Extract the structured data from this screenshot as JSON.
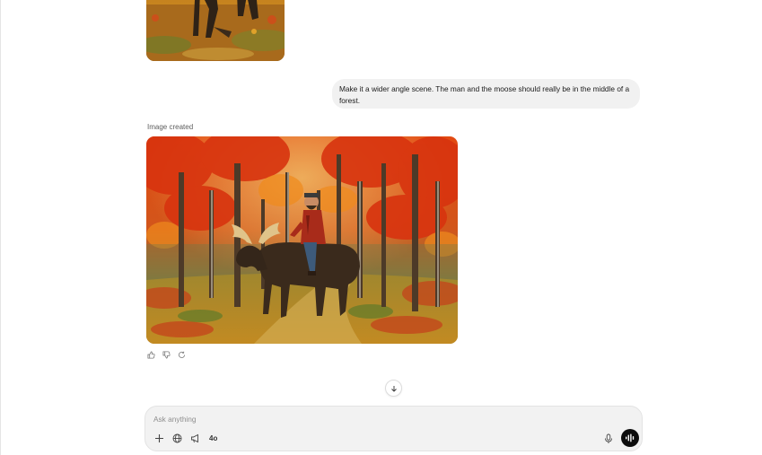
{
  "conversation": {
    "user_message": "Make it a wider angle scene. The man and the moose should really be in the middle of a forest.",
    "image_caption": "Image created"
  },
  "composer": {
    "placeholder": "Ask anything",
    "model_label": "4o"
  },
  "icons": {
    "add": "plus-icon",
    "search": "globe-icon",
    "tools": "megaphone-icon",
    "mic": "microphone-icon",
    "voice": "voice-mode-icon",
    "thumbs_up": "thumbs-up-icon",
    "thumbs_down": "thumbs-down-icon",
    "regenerate": "refresh-icon",
    "scroll_down": "arrow-down-icon"
  },
  "colors": {
    "bubble": "#f1f1f1",
    "composer": "#f2f2f2",
    "voice_button": "#0d0d0d"
  }
}
